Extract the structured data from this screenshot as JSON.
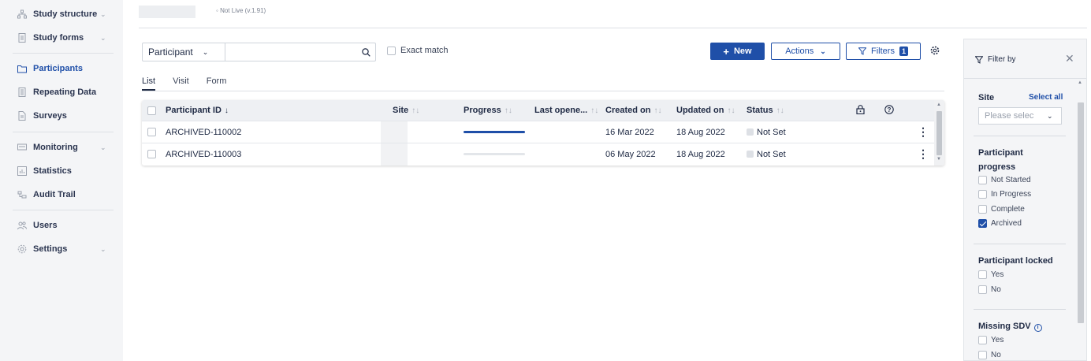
{
  "sidebar": {
    "items": [
      {
        "label": "Study structure",
        "icon": "hierarchy-icon",
        "chevron": true
      },
      {
        "label": "Study forms",
        "icon": "form-icon",
        "chevron": true
      },
      {
        "label": "Participants",
        "icon": "folder-icon",
        "chevron": false,
        "active": true
      },
      {
        "label": "Repeating Data",
        "icon": "document-icon",
        "chevron": false
      },
      {
        "label": "Surveys",
        "icon": "survey-icon",
        "chevron": false
      },
      {
        "label": "Monitoring",
        "icon": "monitor-icon",
        "chevron": true
      },
      {
        "label": "Statistics",
        "icon": "chart-icon",
        "chevron": false
      },
      {
        "label": "Audit Trail",
        "icon": "audit-icon",
        "chevron": false
      },
      {
        "label": "Users",
        "icon": "users-icon",
        "chevron": false
      },
      {
        "label": "Settings",
        "icon": "gear-icon",
        "chevron": true
      }
    ]
  },
  "header": {
    "version": "Not Live (v.1.91)"
  },
  "toolbar": {
    "search_scope": "Participant",
    "search_value": "",
    "exact_match_label": "Exact match",
    "new_label": "New",
    "actions_label": "Actions",
    "filters_label": "Filters",
    "filters_count": "1"
  },
  "tabs": [
    "List",
    "Visit",
    "Form"
  ],
  "table": {
    "columns": [
      "Participant ID",
      "Site",
      "Progress",
      "Last opene...",
      "Created on",
      "Updated on",
      "Status"
    ],
    "rows": [
      {
        "participant_id": "ARCHIVED-110002",
        "progress": 1.0,
        "created_on": "16 Mar 2022",
        "updated_on": "18 Aug 2022",
        "status": "Not Set"
      },
      {
        "participant_id": "ARCHIVED-110003",
        "progress": 0.0,
        "created_on": "06 May 2022",
        "updated_on": "18 Aug 2022",
        "status": "Not Set"
      }
    ]
  },
  "filter_panel": {
    "title": "Filter by",
    "site": {
      "title": "Site",
      "select_all": "Select all",
      "placeholder": "Please selec"
    },
    "progress": {
      "title_line1": "Participant",
      "title_line2": "progress",
      "options": [
        {
          "label": "Not Started",
          "checked": false
        },
        {
          "label": "In Progress",
          "checked": false
        },
        {
          "label": "Complete",
          "checked": false
        },
        {
          "label": "Archived",
          "checked": true
        }
      ]
    },
    "locked": {
      "title": "Participant locked",
      "options": [
        {
          "label": "Yes",
          "checked": false
        },
        {
          "label": "No",
          "checked": false
        }
      ]
    },
    "sdv": {
      "title": "Missing SDV",
      "options": [
        {
          "label": "Yes",
          "checked": false
        },
        {
          "label": "No",
          "checked": false
        }
      ]
    }
  },
  "colors": {
    "accent": "#1f4fa8",
    "sidebar_bg": "#f4f5f7"
  }
}
